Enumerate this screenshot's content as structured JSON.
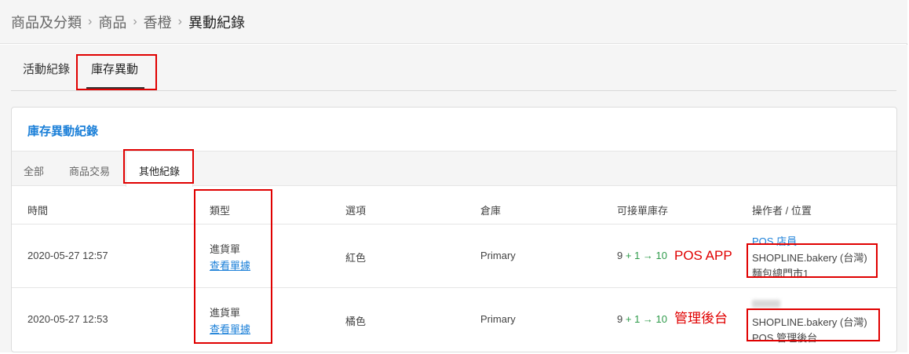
{
  "breadcrumb": {
    "items": [
      "商品及分類",
      "商品",
      "香橙"
    ],
    "current": "異動紀錄",
    "separator": "›"
  },
  "page_tabs": [
    {
      "label": "活動紀錄",
      "active": false
    },
    {
      "label": "庫存異動",
      "active": true
    }
  ],
  "card": {
    "title": "庫存異動紀錄",
    "sub_tabs": [
      {
        "label": "全部",
        "active": false
      },
      {
        "label": "商品交易",
        "active": false
      },
      {
        "label": "其他紀錄",
        "active": true
      }
    ],
    "columns": [
      "時間",
      "類型",
      "選項",
      "倉庫",
      "可接單庫存",
      "操作者 / 位置"
    ],
    "rows": [
      {
        "time": "2020-05-27 12:57",
        "type": "進貨單",
        "doc_link": "查看單據",
        "option": "紅色",
        "warehouse": "Primary",
        "stock_before": "9",
        "stock_delta": "+ 1",
        "arrow": "→",
        "stock_after": "10",
        "operator": "POS 店員",
        "location_line1": "SHOPLINE.bakery (台灣)",
        "location_line2": "麵包總門市1"
      },
      {
        "time": "2020-05-27 12:53",
        "type": "進貨單",
        "doc_link": "查看單據",
        "option": "橘色",
        "warehouse": "Primary",
        "stock_before": "9",
        "stock_delta": "+ 1",
        "arrow": "→",
        "stock_after": "10",
        "location_line1": "SHOPLINE.bakery (台灣)",
        "location_line2": "POS 管理後台"
      }
    ]
  },
  "annotations": {
    "row1_label": "POS APP",
    "row2_label": "管理後台"
  },
  "colors": {
    "accent": "#1a7fd8",
    "positive": "#2e9a4a",
    "annotation": "#e00000"
  }
}
